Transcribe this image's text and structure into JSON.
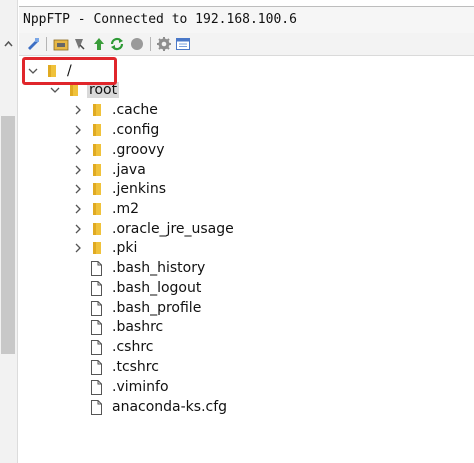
{
  "window": {
    "title": "NppFTP - Connected to 192.168.100.6"
  },
  "toolbar": {
    "buttons": [
      {
        "icon": "connect-icon"
      },
      {
        "icon": "open-folder-icon"
      },
      {
        "icon": "download-icon"
      },
      {
        "icon": "upload-icon"
      },
      {
        "icon": "refresh-icon"
      },
      {
        "icon": "abort-icon"
      },
      {
        "icon": "settings-icon"
      },
      {
        "icon": "message-window-icon"
      }
    ]
  },
  "tree": {
    "root": {
      "label": "/"
    },
    "home": {
      "label": "root"
    },
    "folders": [
      {
        "label": ".cache"
      },
      {
        "label": ".config"
      },
      {
        "label": ".groovy"
      },
      {
        "label": ".java"
      },
      {
        "label": ".jenkins"
      },
      {
        "label": ".m2"
      },
      {
        "label": ".oracle_jre_usage"
      },
      {
        "label": ".pki"
      }
    ],
    "files": [
      {
        "label": ".bash_history"
      },
      {
        "label": ".bash_logout"
      },
      {
        "label": ".bash_profile"
      },
      {
        "label": ".bashrc"
      },
      {
        "label": ".cshrc"
      },
      {
        "label": ".tcshrc"
      },
      {
        "label": ".viminfo"
      },
      {
        "label": "anaconda-ks.cfg"
      }
    ]
  },
  "colors": {
    "highlight": "#e0262b",
    "folder": "#f0c23b",
    "selection": "#d9d9d9"
  }
}
